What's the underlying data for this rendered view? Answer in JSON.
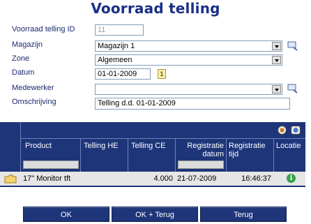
{
  "title": "Voorraad telling",
  "form": {
    "id_label": "Voorraad telling ID",
    "id_value": "11",
    "magazijn_label": "Magazijn",
    "magazijn_value": "Magazijn 1",
    "zone_label": "Zone",
    "zone_value": "Algemeen",
    "datum_label": "Datum",
    "datum_value": "01-01-2009",
    "datum_button": "1",
    "medewerker_label": "Medewerker",
    "medewerker_value": "",
    "omschrijving_label": "Omschrijving",
    "omschrijving_value": "Telling d.d. 01-01-2009"
  },
  "grid": {
    "columns": [
      "Product",
      "Telling HE",
      "Telling CE",
      "Registratie datum",
      "Registratie tijd",
      "Locatie"
    ],
    "rows": [
      {
        "product": "17\" Monitor tft",
        "telling_he": "",
        "telling_ce": "4.000",
        "registratie_datum": "21-07-2009",
        "registratie_tijd": "16:46:37",
        "locatie_icon": "i"
      }
    ]
  },
  "buttons": {
    "ok": "OK",
    "ok_terug": "OK + Terug",
    "terug": "Terug"
  },
  "colors": {
    "grid_header": "#1e3579",
    "title": "#1b2f86",
    "info": "#34a34a"
  },
  "icons": [
    "search-icon",
    "calendar-icon",
    "folder-icon",
    "info-icon",
    "export-icon",
    "refresh-icon"
  ]
}
